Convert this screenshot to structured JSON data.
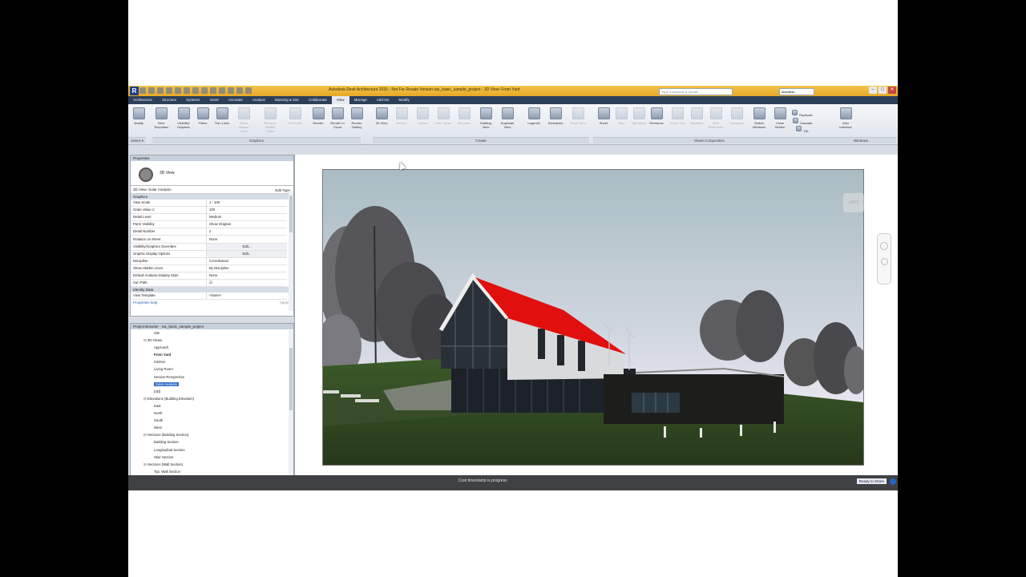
{
  "window": {
    "title": "Autodesk Revit Architecture 2015 - Not For Resale Version    rac_basic_sample_project - 3D View: From Yard",
    "search_placeholder": "Type a keyword or phrase",
    "user": "autodesk"
  },
  "ribbon_tabs": [
    "Architecture",
    "Structure",
    "Systems",
    "Insert",
    "Annotate",
    "Analyze",
    "Massing & Site",
    "Collaborate",
    "View",
    "Manage",
    "Add-Ins",
    "Modify"
  ],
  "active_tab": "View",
  "ribbon": {
    "buttons": [
      {
        "label": "Modify"
      },
      {
        "label": "View Templates"
      },
      {
        "label": "Visibility/ Graphics"
      },
      {
        "label": "Filters"
      },
      {
        "label": "Thin Lines"
      },
      {
        "label": "Show Hidden Lines"
      },
      {
        "label": "Remove Hidden Lines"
      },
      {
        "label": "Cut Profile"
      },
      {
        "label": "Render"
      },
      {
        "label": "Render in Cloud"
      },
      {
        "label": "Render Gallery"
      },
      {
        "label": "3D View"
      },
      {
        "label": "Section"
      },
      {
        "label": "Callout"
      },
      {
        "label": "Plan Views"
      },
      {
        "label": "Elevation"
      },
      {
        "label": "Drafting View"
      },
      {
        "label": "Duplicate View"
      },
      {
        "label": "Legends"
      },
      {
        "label": "Schedules"
      },
      {
        "label": "Scope Box"
      },
      {
        "label": "Sheet"
      },
      {
        "label": "View"
      },
      {
        "label": "Title Block"
      },
      {
        "label": "Revisions"
      },
      {
        "label": "Guide Grid"
      },
      {
        "label": "Matchline"
      },
      {
        "label": "View Reference"
      },
      {
        "label": "Viewports"
      },
      {
        "label": "Switch Windows"
      },
      {
        "label": "Close Hidden"
      },
      {
        "label": "Replicate"
      },
      {
        "label": "Cascade"
      },
      {
        "label": "Tile"
      },
      {
        "label": "User Interface"
      }
    ],
    "panels": [
      "Select ▾",
      "Graphics",
      "Create",
      "Sheet Composition",
      "Windows"
    ]
  },
  "properties": {
    "header": "Properties",
    "type_name": "3D View",
    "instance_label": "3D View: Solar Analysis",
    "edit_type": "Edit Type",
    "group_graphics": "Graphics",
    "rows": [
      {
        "k": "View Scale",
        "v": "1 : 100"
      },
      {
        "k": "Scale Value    1:",
        "v": "100"
      },
      {
        "k": "Detail Level",
        "v": "Medium"
      },
      {
        "k": "Parts Visibility",
        "v": "Show Original"
      },
      {
        "k": "Detail Number",
        "v": "2"
      },
      {
        "k": "Rotation on Sheet",
        "v": "None"
      },
      {
        "k": "Visibility/Graphics Overrides",
        "v": "Edit..."
      },
      {
        "k": "Graphic Display Options",
        "v": "Edit..."
      },
      {
        "k": "Discipline",
        "v": "Coordination"
      },
      {
        "k": "Show Hidden Lines",
        "v": "By Discipline"
      },
      {
        "k": "Default Analysis Display Style",
        "v": "None"
      },
      {
        "k": "Sun Path",
        "v": "☑"
      }
    ],
    "group_identity": "Identity Data",
    "identity_rows": [
      {
        "k": "View Template",
        "v": "<None>"
      }
    ],
    "help_link": "Properties help",
    "apply": "Apply"
  },
  "project_browser": {
    "header": "Project Browser - rac_basic_sample_project",
    "nodes": [
      {
        "label": "Site",
        "indent": 3,
        "tw": ""
      },
      {
        "label": "3D Views",
        "indent": 2,
        "tw": "⊟"
      },
      {
        "label": "Approach",
        "indent": 3,
        "tw": ""
      },
      {
        "label": "From Yard",
        "indent": 3,
        "tw": "",
        "bold": true
      },
      {
        "label": "Kitchen",
        "indent": 3,
        "tw": ""
      },
      {
        "label": "Living Room",
        "indent": 3,
        "tw": ""
      },
      {
        "label": "Section Perspective",
        "indent": 3,
        "tw": ""
      },
      {
        "label": "Solar Analysis",
        "indent": 3,
        "tw": "",
        "selected": true
      },
      {
        "label": "{3D}",
        "indent": 3,
        "tw": ""
      },
      {
        "label": "Elevations (Building Elevation)",
        "indent": 2,
        "tw": "⊟"
      },
      {
        "label": "East",
        "indent": 3,
        "tw": ""
      },
      {
        "label": "North",
        "indent": 3,
        "tw": ""
      },
      {
        "label": "South",
        "indent": 3,
        "tw": ""
      },
      {
        "label": "West",
        "indent": 3,
        "tw": ""
      },
      {
        "label": "Sections (Building Section)",
        "indent": 2,
        "tw": "⊟"
      },
      {
        "label": "Building Section",
        "indent": 3,
        "tw": ""
      },
      {
        "label": "Longitudinal Section",
        "indent": 3,
        "tw": ""
      },
      {
        "label": "Stair Section",
        "indent": 3,
        "tw": ""
      },
      {
        "label": "Sections (Wall Section)",
        "indent": 2,
        "tw": "⊟"
      },
      {
        "label": "Typ. Wall Section",
        "indent": 3,
        "tw": ""
      }
    ]
  },
  "viewcube_label": "LEFT",
  "status": {
    "message": "Cost timestamp is progress",
    "workset": "Ready to Share"
  },
  "colors": {
    "roof": "#e1100f",
    "sky_top": "#a9bcc3",
    "grass": "#2f4521"
  }
}
